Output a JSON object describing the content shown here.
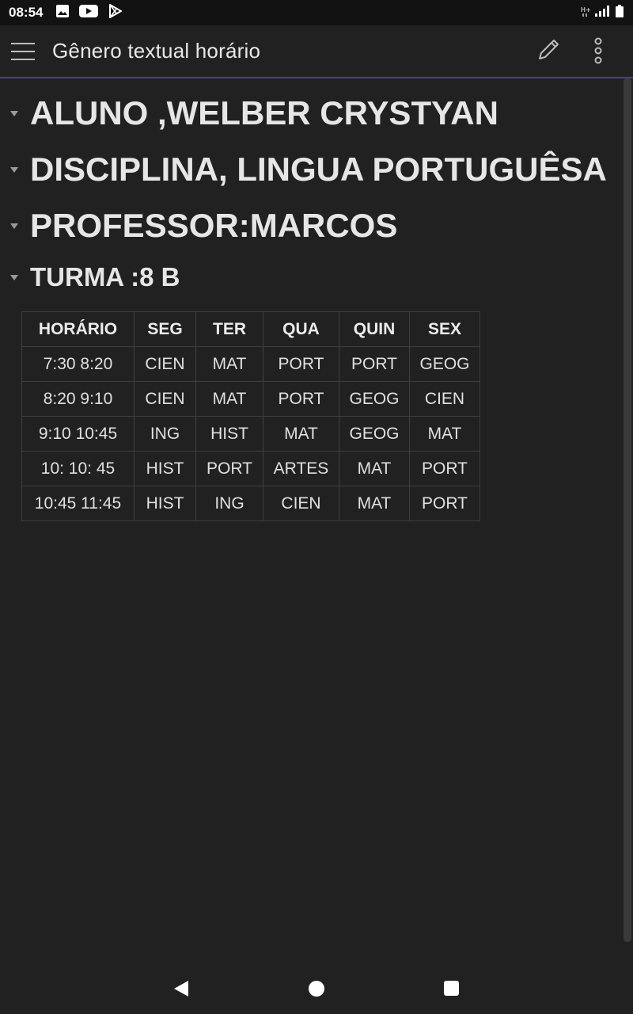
{
  "status_bar": {
    "time": "08:54",
    "left_icons": [
      "image-icon",
      "youtube-icon",
      "play-store-icon"
    ],
    "right_icons": [
      "h-plus-icon",
      "signal-icon",
      "battery-icon"
    ]
  },
  "app_bar": {
    "title": "Gênero textual horário",
    "icons": [
      "menu-icon",
      "edit-pencil-icon",
      "more-vert-icon"
    ]
  },
  "document": {
    "headings": [
      {
        "text": "ALUNO ,WELBER CRYSTYAN",
        "level": 1
      },
      {
        "text": "DISCIPLINA, LINGUA PORTUGUÊSA",
        "level": 1
      },
      {
        "text": "PROFESSOR:MARCOS",
        "level": 1
      },
      {
        "text": "TURMA :8 B",
        "level": 2
      }
    ],
    "table": {
      "headers": [
        "HORÁRIO",
        "SEG",
        "TER",
        "QUA",
        "QUIN",
        "SEX"
      ],
      "rows": [
        [
          "7:30 8:20",
          "CIEN",
          "MAT",
          "PORT",
          "PORT",
          "GEOG"
        ],
        [
          "8:20 9:10",
          "CIEN",
          "MAT",
          "PORT",
          "GEOG",
          "CIEN"
        ],
        [
          "9:10 10:45",
          "ING",
          "HIST",
          "MAT",
          "GEOG",
          "MAT"
        ],
        [
          "10: 10: 45",
          "HIST",
          "PORT",
          "ARTES",
          "MAT",
          "PORT"
        ],
        [
          "10:45 11:45",
          "HIST",
          "ING",
          "CIEN",
          "MAT",
          "PORT"
        ]
      ]
    }
  },
  "nav_bar": {
    "icons": [
      "back-icon",
      "home-icon",
      "recents-icon"
    ]
  },
  "colors": {
    "background": "#212121",
    "status_bar": "#121212",
    "app_bar_divider": "#4b3f8a",
    "text": "#e6e6e6",
    "table_border": "#3e3e3e"
  }
}
